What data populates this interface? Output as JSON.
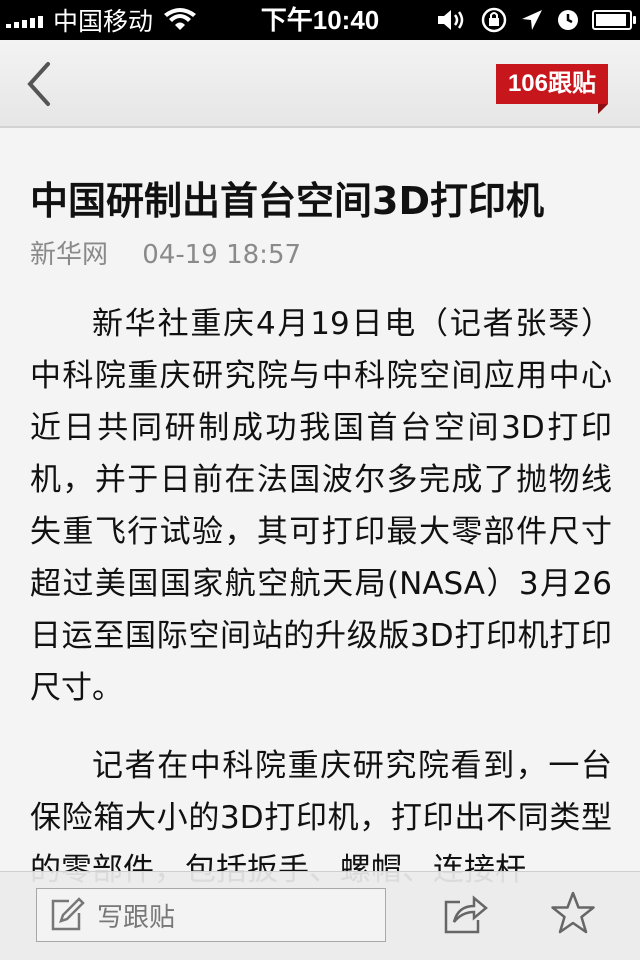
{
  "status_bar": {
    "carrier": "中国移动",
    "time": "下午10:40"
  },
  "nav": {
    "back_icon": "chevron-left-icon",
    "comment_count": "106跟贴"
  },
  "article": {
    "title": "中国研制出首台空间3D打印机",
    "source": "新华网",
    "time": "04-19 18:57",
    "paragraphs": [
      "新华社重庆4月19日电（记者张琴）中科院重庆研究院与中科院空间应用中心近日共同研制成功我国首台空间3D打印机，并于日前在法国波尔多完成了抛物线失重飞行试验，其可打印最大零部件尺寸超过美国国家航空航天局(NASA）3月26日运至国际空间站的升级版3D打印机打印尺寸。",
      "记者在中科院重庆研究院看到，一台保险箱大小的3D打印机，打印出不同类型的零部件，包括扳手、螺帽、连接杆"
    ]
  },
  "toolbar": {
    "write_label": "写跟贴",
    "icons": [
      "edit-icon",
      "share-icon",
      "star-icon"
    ]
  },
  "colors": {
    "accent": "#c8161d",
    "status_bar_bg": "#000000",
    "page_bg": "#f4f4f4"
  }
}
